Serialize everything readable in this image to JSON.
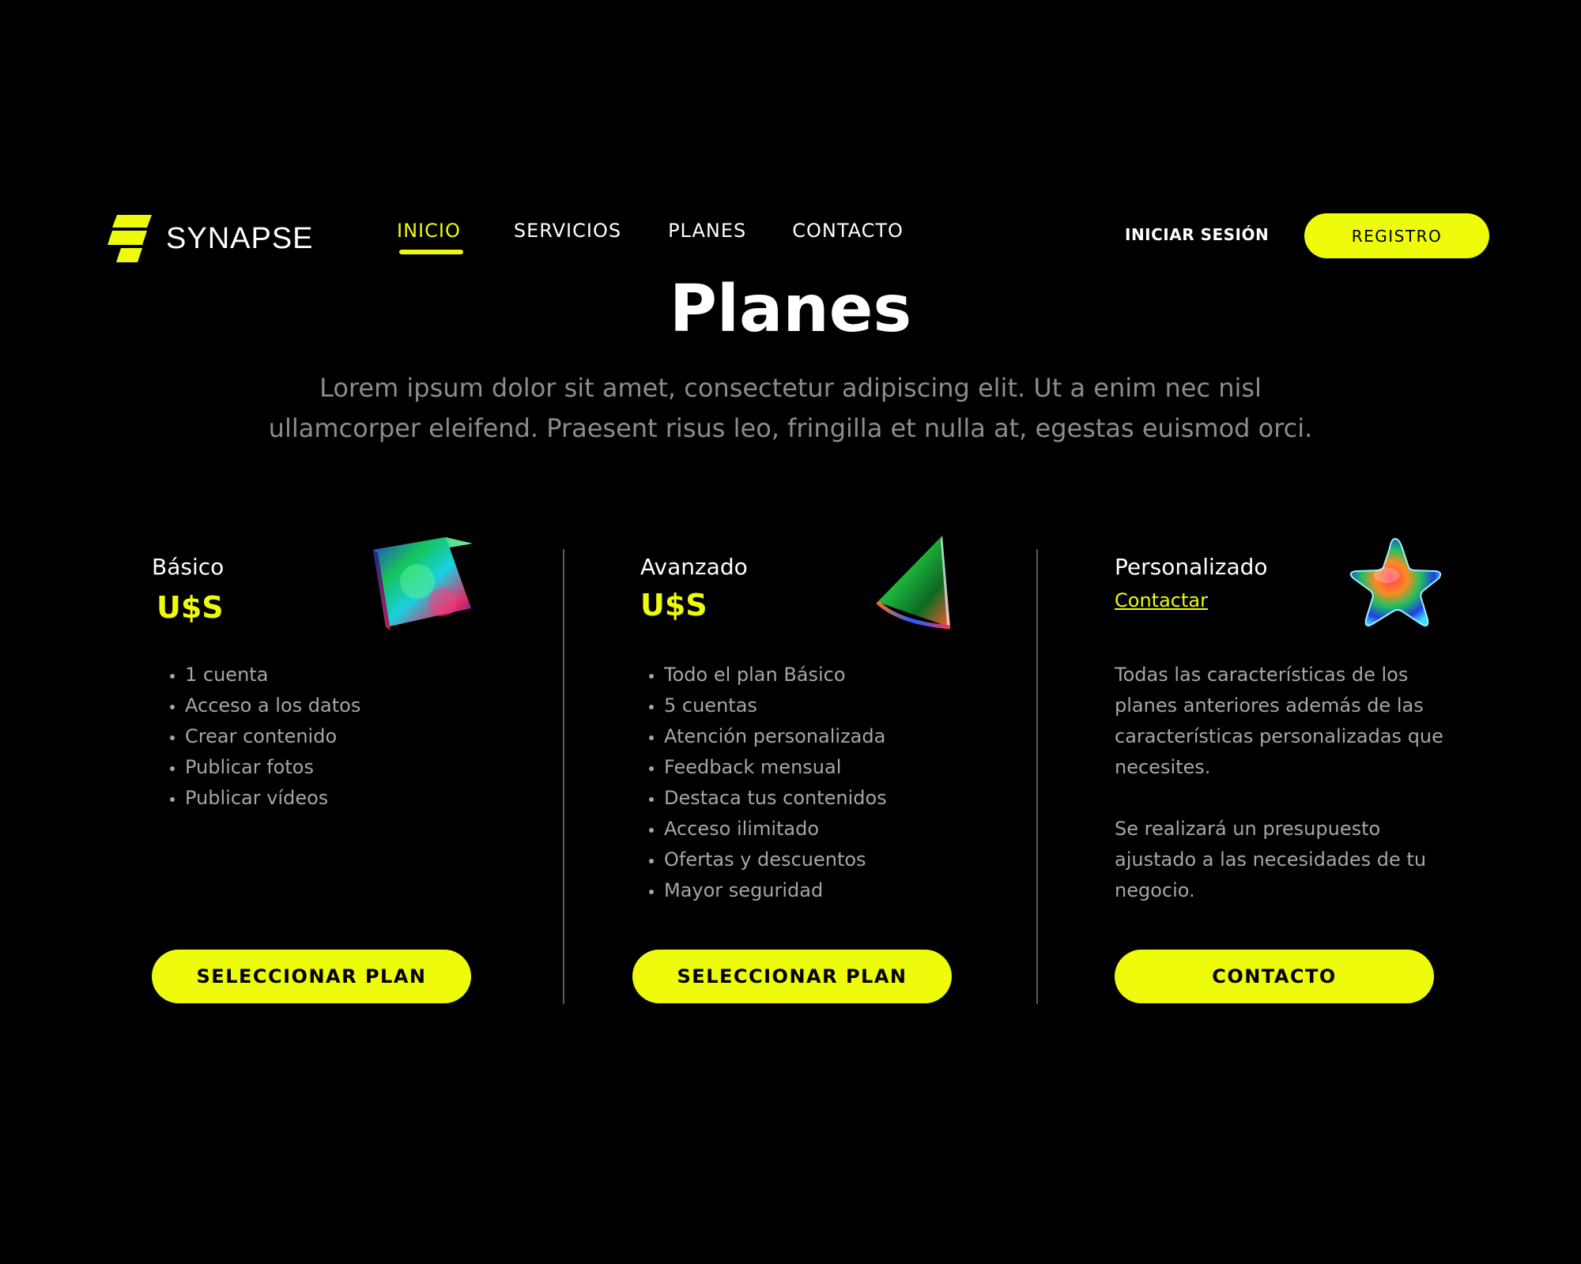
{
  "colors": {
    "accent": "#eefb0a",
    "background": "#000000",
    "text": "#ffffff",
    "muted_text": "#a6a6a6"
  },
  "header": {
    "brand": "SYNAPSE",
    "logo_icon": "synapse-parallelogram-logo",
    "nav": [
      {
        "label": "INICIO",
        "active": true
      },
      {
        "label": "SERVICIOS",
        "active": false
      },
      {
        "label": "PLANES",
        "active": false
      },
      {
        "label": "CONTACTO",
        "active": false
      }
    ],
    "login_label": "INICIAR SESIÓN",
    "register_label": "REGISTRO"
  },
  "hero": {
    "title": "Planes",
    "intro_line1": "Lorem ipsum dolor sit amet, consectetur adipiscing elit. Ut a enim nec nisl",
    "intro_line2": "ullamcorper eleifend. Praesent risus leo, fringilla et nulla at, egestas euismod orci."
  },
  "plans": [
    {
      "name": "Básico",
      "price": "U$S",
      "icon": "holographic-cube-icon",
      "features": [
        "1 cuenta",
        "Acceso a los datos",
        "Crear contenido",
        "Publicar fotos",
        "Publicar vídeos"
      ],
      "button_label": "SELECCIONAR PLAN"
    },
    {
      "name": "Avanzado",
      "price": "U$S",
      "icon": "holographic-cone-icon",
      "features": [
        "Todo el plan Básico",
        "5 cuentas",
        "Atención personalizada",
        "Feedback mensual",
        "Destaca tus contenidos",
        "Acceso ilimitado",
        "Ofertas y descuentos",
        "Mayor seguridad"
      ],
      "button_label": "SELECCIONAR PLAN"
    },
    {
      "name": "Personalizado",
      "link_label": "Contactar",
      "icon": "holographic-star-icon",
      "description_1": "Todas las características de los planes anteriores además de las características personalizadas que necesites.",
      "description_2": "Se realizará un presupuesto ajustado a las necesidades de tu negocio.",
      "button_label": "CONTACTO"
    }
  ]
}
